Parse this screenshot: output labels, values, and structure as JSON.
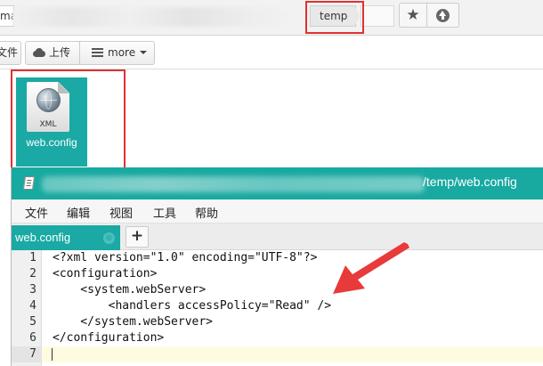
{
  "breadcrumb": {
    "first_partial": "ma",
    "current": "temp"
  },
  "toolbar": {
    "file_label": "文件",
    "upload_label": "上传",
    "more_label": "more"
  },
  "file_tile": {
    "icon_label": "XML",
    "name": "web.config"
  },
  "editor": {
    "title": "/temp/web.config",
    "menu": [
      "文件",
      "编辑",
      "视图",
      "工具",
      "帮助"
    ],
    "tab": {
      "label": "web.config",
      "close_glyph": "⊗"
    },
    "add_tab_label": "+",
    "lines": [
      {
        "number": "1",
        "text": "<?xml version=\"1.0\" encoding=\"UTF-8\"?>"
      },
      {
        "number": "2",
        "text": "<configuration>"
      },
      {
        "number": "3",
        "text": "    <system.webServer>"
      },
      {
        "number": "4",
        "text": "        <handlers accessPolicy=\"Read\" />"
      },
      {
        "number": "5",
        "text": "    </system.webServer>"
      },
      {
        "number": "6",
        "text": "</configuration>"
      },
      {
        "number": "7",
        "text": ""
      }
    ]
  },
  "colors": {
    "accent_teal": "#1aa9a4",
    "highlight_red": "#e03232"
  },
  "icons": {
    "star": "star-icon",
    "up": "arrow-up-circle-icon",
    "upload": "cloud-upload-icon",
    "more": "list-icon"
  }
}
